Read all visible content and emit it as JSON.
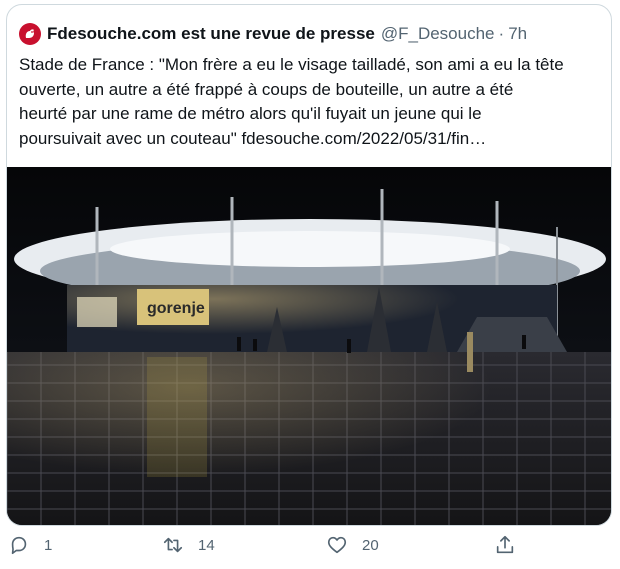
{
  "tweet": {
    "author_name": "Fdesouche.com est une revue de presse",
    "handle": "@F_Desouche",
    "separator": "·",
    "time": "7h",
    "text": "Stade de France : \"Mon frère a eu le visage tailladé, son ami a eu la tête\nouverte, un autre a été frappé à coups de bouteille, un autre a été\nheurté par une rame de métro alors qu'il fuyait un jeune qui le\npoursuivait avec un couteau\" fdesouche.com/2022/05/31/fin…",
    "image_sign_text": "gorenje"
  },
  "actions": {
    "reply_count": "1",
    "retweet_count": "14",
    "like_count": "20"
  },
  "icons": {
    "avatar": "rooster-logo-icon",
    "reply": "reply-icon",
    "retweet": "retweet-icon",
    "like": "heart-icon",
    "share": "share-icon"
  },
  "colors": {
    "text": "#0f1419",
    "secondary": "#536471",
    "border": "#cfd9de",
    "avatar_red": "#c8102e"
  }
}
